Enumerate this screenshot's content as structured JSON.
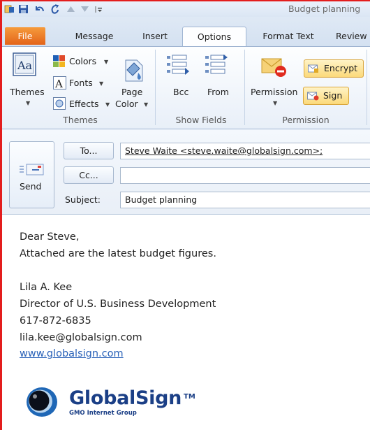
{
  "window": {
    "title": "Budget planning"
  },
  "tabs": [
    {
      "label": "File"
    },
    {
      "label": "Message"
    },
    {
      "label": "Insert"
    },
    {
      "label": "Options"
    },
    {
      "label": "Format Text"
    },
    {
      "label": "Review"
    }
  ],
  "ribbon": {
    "themes": {
      "themes_label": "Themes",
      "colors_label": "Colors",
      "fonts_label": "Fonts",
      "effects_label": "Effects",
      "page_color_label_1": "Page",
      "page_color_label_2": "Color",
      "group_label": "Themes"
    },
    "show_fields": {
      "bcc_label": "Bcc",
      "from_label": "From",
      "group_label": "Show Fields"
    },
    "permission": {
      "permission_label": "Permission",
      "encrypt_label": "Encrypt",
      "sign_label": "Sign",
      "group_label": "Permission"
    }
  },
  "compose": {
    "send_label": "Send",
    "to_button": "To...",
    "cc_button": "Cc...",
    "subject_label": "Subject:",
    "to_value": "Steve Waite <steve.waite@globalsign.com>;",
    "cc_value": "",
    "subject_value": "Budget planning"
  },
  "body": {
    "greeting": "Dear Steve,",
    "line1": "Attached are the latest budget figures.",
    "sig_name": "Lila A. Kee",
    "sig_title": "Director of U.S. Business Development",
    "sig_phone": "617-872-6835",
    "sig_email": "lila.kee@globalsign.com",
    "sig_url": "www.globalsign.com",
    "logo_name": "GlobalSign",
    "logo_tm": "TM",
    "logo_sub": "GMO Internet Group"
  },
  "colors": {
    "accent_red": "#e31d1d",
    "file_tab": "#e86e20",
    "logo_blue": "#1b3f86",
    "link_blue": "#2a62b8"
  }
}
